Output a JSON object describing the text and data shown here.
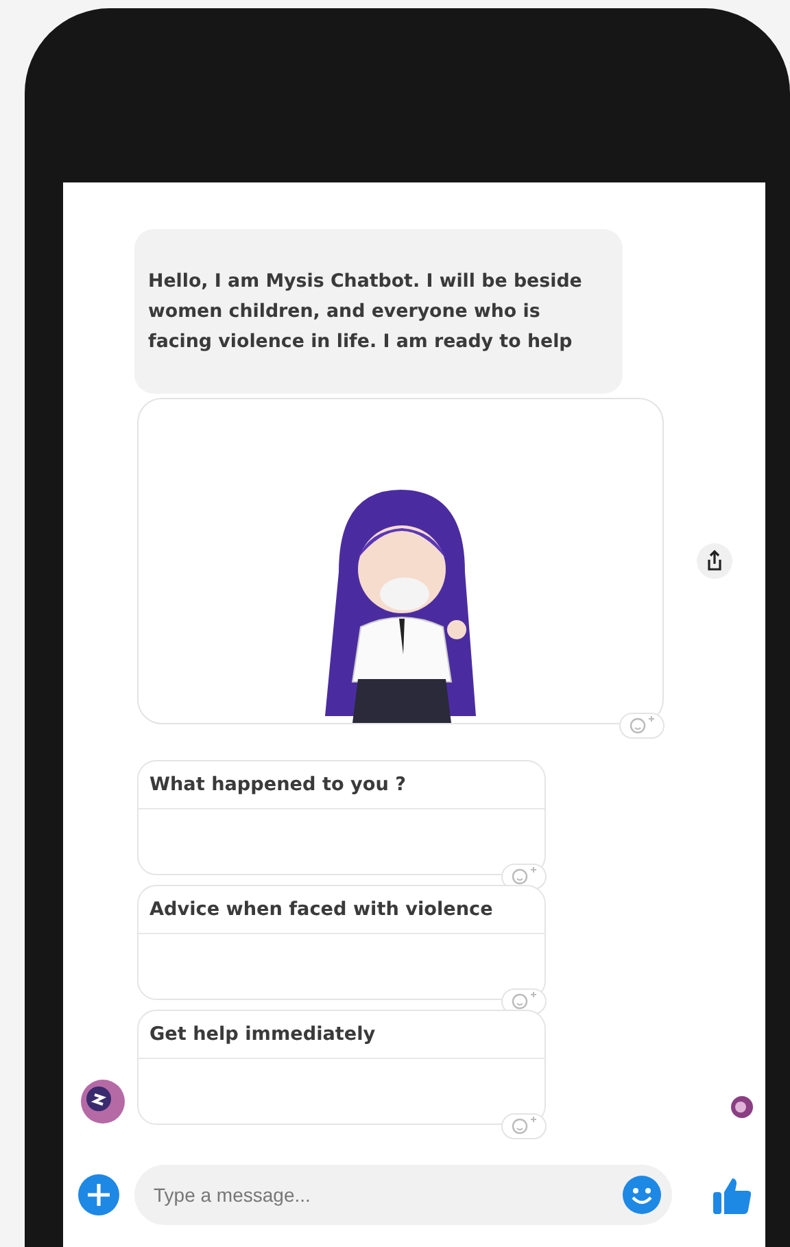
{
  "messages": [
    {
      "kind": "text",
      "text": "Hello, I am Mysis Chatbot. I will be beside women children, and everyone who is facing violence in life. I am ready to help"
    },
    {
      "kind": "picture"
    }
  ],
  "quick_replies": [
    {
      "label": "What happened to you ?"
    },
    {
      "label": "Advice when faced with violence"
    },
    {
      "label": "Get help immediately"
    }
  ],
  "composer": {
    "placeholder": "Type a message..."
  }
}
